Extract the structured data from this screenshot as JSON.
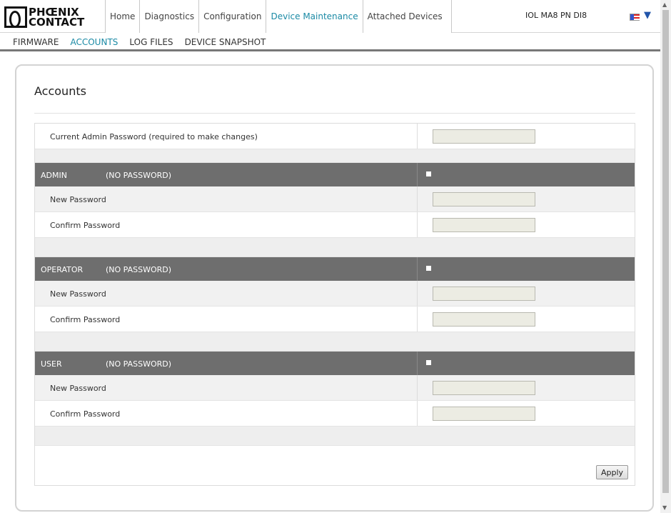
{
  "header": {
    "logo_line1": "PHŒNIX",
    "logo_line2": "CONTACT",
    "tabs": [
      {
        "label": "Home",
        "active": false
      },
      {
        "label": "Diagnostics",
        "active": false
      },
      {
        "label": "Configuration",
        "active": false
      },
      {
        "label": "Device Maintenance",
        "active": true
      },
      {
        "label": "Attached Devices",
        "active": false
      }
    ],
    "device_name": "IOL MA8 PN DI8",
    "language_icon": "us-flag-icon",
    "language_arrow": "▼"
  },
  "subnav": {
    "items": [
      {
        "label": "FIRMWARE",
        "active": false
      },
      {
        "label": "ACCOUNTS",
        "active": true
      },
      {
        "label": "LOG FILES",
        "active": false
      },
      {
        "label": "DEVICE SNAPSHOT",
        "active": false
      }
    ]
  },
  "page": {
    "title": "Accounts",
    "current_admin_label": "Current Admin Password (required to make changes)",
    "current_admin_value": "",
    "sections": [
      {
        "role": "ADMIN",
        "status": "(NO PASSWORD)",
        "new_label": "New Password",
        "confirm_label": "Confirm Password",
        "new_value": "",
        "confirm_value": ""
      },
      {
        "role": "OPERATOR",
        "status": "(NO PASSWORD)",
        "new_label": "New Password",
        "confirm_label": "Confirm Password",
        "new_value": "",
        "confirm_value": ""
      },
      {
        "role": "USER",
        "status": "(NO PASSWORD)",
        "new_label": "New Password",
        "confirm_label": "Confirm Password",
        "new_value": "",
        "confirm_value": ""
      }
    ],
    "apply_label": "Apply"
  },
  "colors": {
    "accent": "#1b8aa5",
    "section_header": "#6e6e6e",
    "input_bg": "#ecece3"
  }
}
